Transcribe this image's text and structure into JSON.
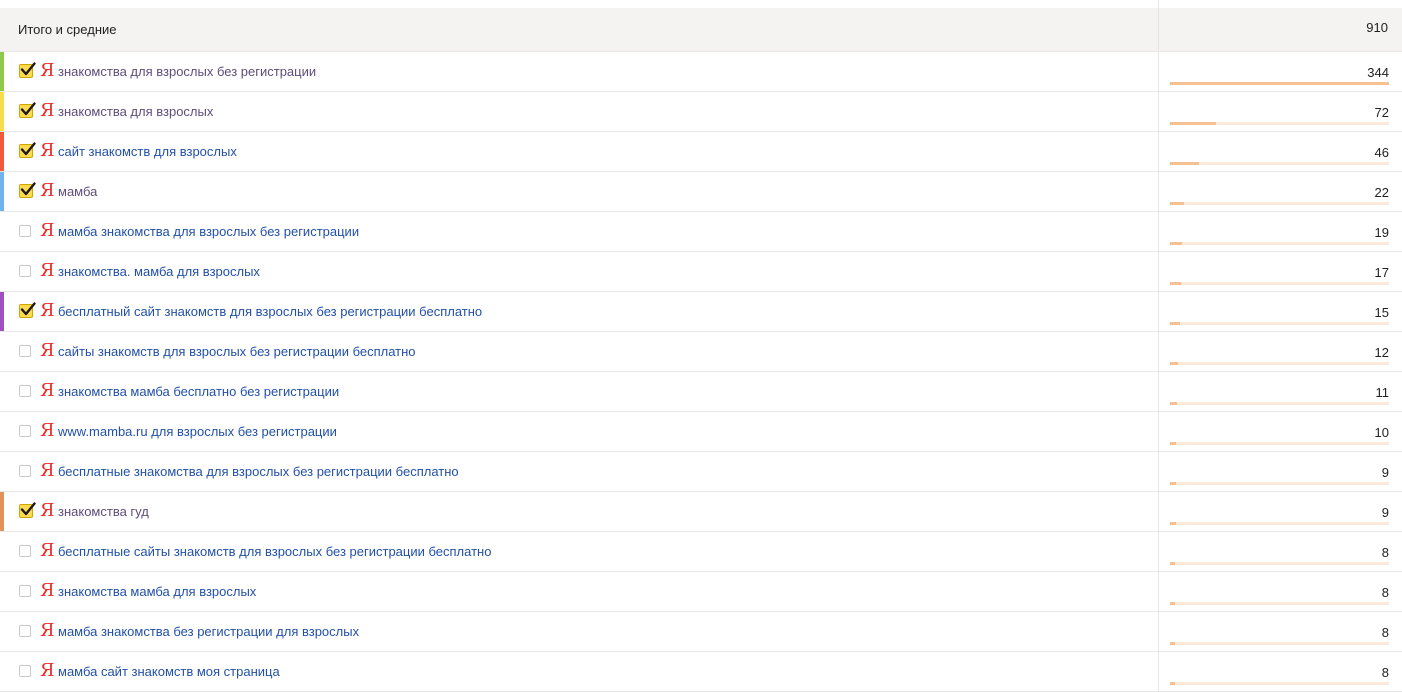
{
  "total": {
    "label": "Итого и средние",
    "value": "910"
  },
  "colors": {
    "link": "#2250a8",
    "visited": "#5e4d7a",
    "yandex_red": "#e8302d",
    "checkbox_yellow": "#ffdb4d",
    "bar_fill": "#f7c092",
    "bar_track": "#fbe9d9"
  },
  "rows": [
    {
      "phrase": "знакомства для взрослых без регистрации",
      "value": "344",
      "share": 1.0,
      "checked": true,
      "stripe": "#8fcb4a",
      "visited": true,
      "icon": "yandex-icon"
    },
    {
      "phrase": "знакомства для взрослых",
      "value": "72",
      "share": 0.2093,
      "checked": true,
      "stripe": "#f7dd4c",
      "visited": true,
      "icon": "yandex-icon"
    },
    {
      "phrase": "сайт знакомств для взрослых",
      "value": "46",
      "share": 0.1337,
      "checked": true,
      "stripe": "#f35a3c",
      "visited": false,
      "icon": "yandex-icon"
    },
    {
      "phrase": "мамба",
      "value": "22",
      "share": 0.064,
      "checked": true,
      "stripe": "#6fb4ea",
      "visited": true,
      "icon": "yandex-icon"
    },
    {
      "phrase": "мамба знакомства для взрослых без регистрации",
      "value": "19",
      "share": 0.0552,
      "checked": false,
      "stripe": "",
      "visited": false,
      "icon": "yandex-icon"
    },
    {
      "phrase": "знакомства. мамба для взрослых",
      "value": "17",
      "share": 0.0494,
      "checked": false,
      "stripe": "",
      "visited": false,
      "icon": "yandex-icon"
    },
    {
      "phrase": "бесплатный сайт знакомств для взрослых без регистрации бесплатно",
      "value": "15",
      "share": 0.0436,
      "checked": true,
      "stripe": "#9e4fc0",
      "visited": false,
      "icon": "yandex-icon"
    },
    {
      "phrase": "сайты знакомств для взрослых без регистрации бесплатно",
      "value": "12",
      "share": 0.0349,
      "checked": false,
      "stripe": "",
      "visited": false,
      "icon": "yandex-icon"
    },
    {
      "phrase": "знакомства мамба бесплатно без регистрации",
      "value": "11",
      "share": 0.032,
      "checked": false,
      "stripe": "",
      "visited": false,
      "icon": "yandex-icon"
    },
    {
      "phrase": "www.mamba.ru для взрослых без регистрации",
      "value": "10",
      "share": 0.0291,
      "checked": false,
      "stripe": "",
      "visited": false,
      "icon": "yandex-icon"
    },
    {
      "phrase": "бесплатные знакомства для взрослых без регистрации бесплатно",
      "value": "9",
      "share": 0.0262,
      "checked": false,
      "stripe": "",
      "visited": false,
      "icon": "yandex-icon"
    },
    {
      "phrase": "знакомства гуд",
      "value": "9",
      "share": 0.0262,
      "checked": true,
      "stripe": "#e2935a",
      "visited": true,
      "icon": "yandex-icon"
    },
    {
      "phrase": "бесплатные сайты знакомств для взрослых без регистрации бесплатно",
      "value": "8",
      "share": 0.0233,
      "checked": false,
      "stripe": "",
      "visited": false,
      "icon": "yandex-icon"
    },
    {
      "phrase": "знакомства мамба для взрослых",
      "value": "8",
      "share": 0.0233,
      "checked": false,
      "stripe": "",
      "visited": false,
      "icon": "yandex-icon"
    },
    {
      "phrase": "мамба знакомства без регистрации для взрослых",
      "value": "8",
      "share": 0.0233,
      "checked": false,
      "stripe": "",
      "visited": false,
      "icon": "yandex-icon"
    },
    {
      "phrase": "мамба сайт знакомств моя страница",
      "value": "8",
      "share": 0.0233,
      "checked": false,
      "stripe": "",
      "visited": false,
      "icon": "yandex-icon"
    }
  ]
}
